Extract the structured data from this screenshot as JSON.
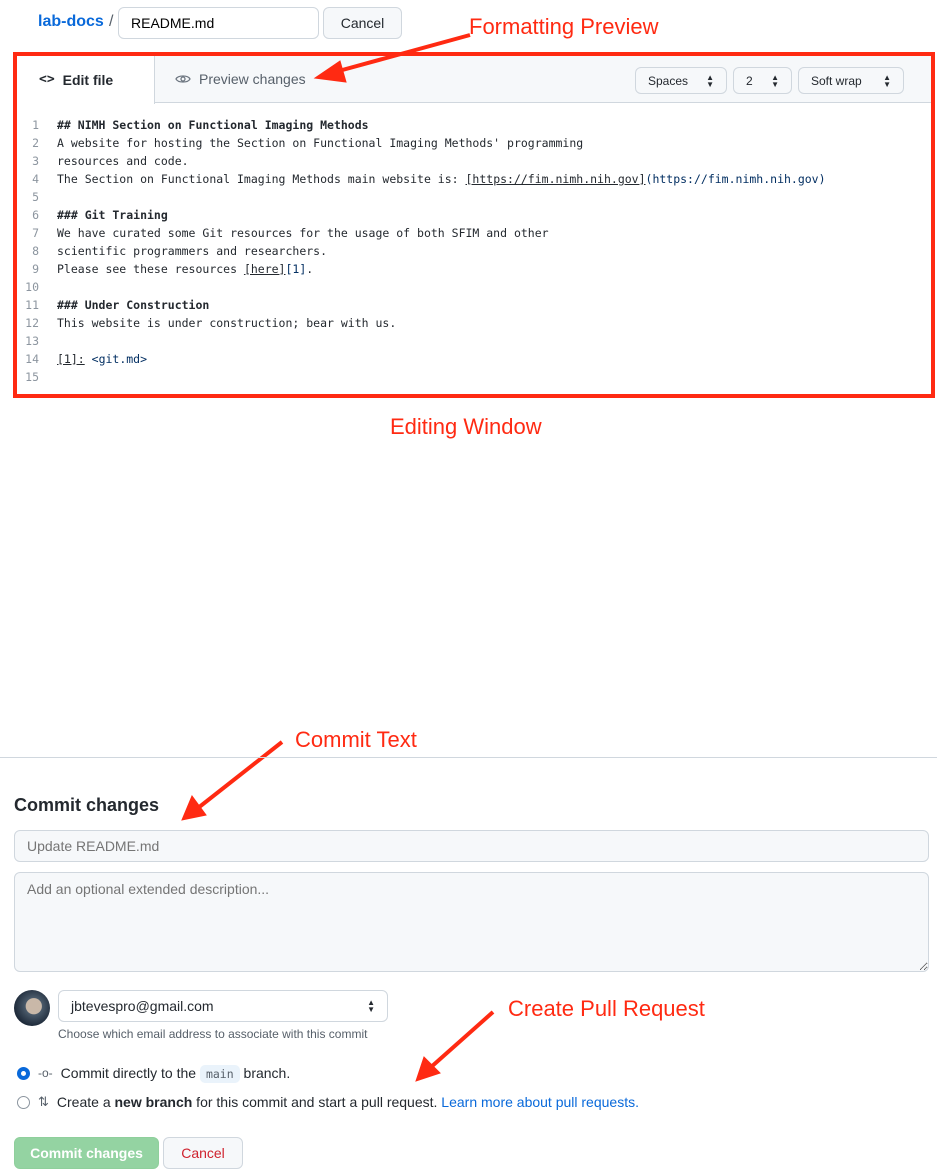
{
  "header": {
    "repo": "lab-docs",
    "separator": "/",
    "filename": "README.md",
    "cancel": "Cancel"
  },
  "editor": {
    "tabs": [
      {
        "label": "Edit file",
        "icon": "code-icon"
      },
      {
        "label": "Preview changes",
        "icon": "eye-icon"
      }
    ],
    "indent_mode": "Spaces",
    "indent_size": "2",
    "wrap_mode": "Soft wrap",
    "lines": [
      {
        "n": "1",
        "parts": [
          {
            "t": "## NIMH Section on Functional Imaging Methods",
            "c": "b"
          }
        ]
      },
      {
        "n": "2",
        "parts": [
          {
            "t": "A website for hosting the Section on Functional Imaging Methods' programming",
            "c": ""
          }
        ]
      },
      {
        "n": "3",
        "parts": [
          {
            "t": "resources and code.",
            "c": ""
          }
        ]
      },
      {
        "n": "4",
        "parts": [
          {
            "t": "The Section on Functional Imaging Methods main website is: ",
            "c": ""
          },
          {
            "t": "[https://fim.nimh.nih.gov]",
            "c": "u"
          },
          {
            "t": "(https://fim.nimh.nih.gov)",
            "c": "url"
          }
        ]
      },
      {
        "n": "5",
        "parts": []
      },
      {
        "n": "6",
        "parts": [
          {
            "t": "### Git Training",
            "c": "b"
          }
        ]
      },
      {
        "n": "7",
        "parts": [
          {
            "t": "We have curated some Git resources for the usage of both SFIM and other",
            "c": ""
          }
        ]
      },
      {
        "n": "8",
        "parts": [
          {
            "t": "scientific programmers and researchers.",
            "c": ""
          }
        ]
      },
      {
        "n": "9",
        "parts": [
          {
            "t": "Please see these resources ",
            "c": ""
          },
          {
            "t": "[here]",
            "c": "u"
          },
          {
            "t": "[1]",
            "c": "url"
          },
          {
            "t": ".",
            "c": ""
          }
        ]
      },
      {
        "n": "10",
        "parts": []
      },
      {
        "n": "11",
        "parts": [
          {
            "t": "### Under Construction",
            "c": "b"
          }
        ]
      },
      {
        "n": "12",
        "parts": [
          {
            "t": "This website is under construction; bear with us.",
            "c": ""
          }
        ]
      },
      {
        "n": "13",
        "parts": []
      },
      {
        "n": "14",
        "parts": [
          {
            "t": "[1]:",
            "c": "u"
          },
          {
            "t": " ",
            "c": ""
          },
          {
            "t": "<git.md>",
            "c": "url"
          }
        ]
      },
      {
        "n": "15",
        "parts": []
      }
    ]
  },
  "annotations": {
    "formatting": "Formatting Preview",
    "editing": "Editing Window",
    "commit_text": "Commit Text",
    "pull_request": "Create Pull Request",
    "color": "#ff2a12"
  },
  "commit": {
    "heading": "Commit changes",
    "summary_placeholder": "Update README.md",
    "description_placeholder": "Add an optional extended description...",
    "email": "jbtevespro@gmail.com",
    "email_hint": "Choose which email address to associate with this commit",
    "option1": {
      "pre": "Commit directly to the ",
      "branch": "main",
      "post": " branch.",
      "selected": true
    },
    "option2": {
      "pre": "Create a ",
      "bold": "new branch",
      "post": " for this commit and start a pull request. ",
      "link": "Learn more about pull requests.",
      "selected": false
    },
    "submit": "Commit changes",
    "cancel": "Cancel"
  }
}
